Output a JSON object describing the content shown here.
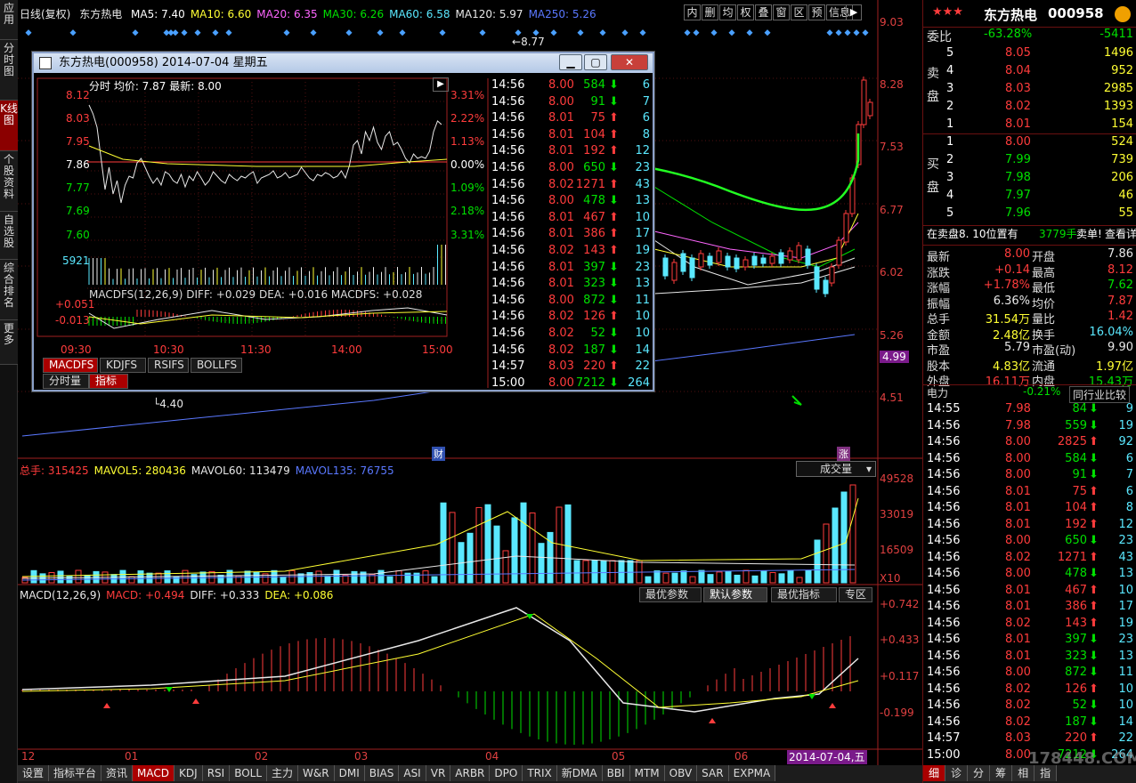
{
  "left_tabs": [
    "应用",
    "分时图",
    "K线图",
    "个股资料",
    "自选股",
    "综合排名",
    "更多"
  ],
  "header": {
    "period": "日线(复权)",
    "stock": "东方热电",
    "ma": [
      {
        "label": "MA5: 7.40",
        "color": "#ffffff"
      },
      {
        "label": "MA10: 6.60",
        "color": "#ffff33"
      },
      {
        "label": "MA20: 6.35",
        "color": "#ff66ff"
      },
      {
        "label": "MA30: 6.26",
        "color": "#00e000"
      },
      {
        "label": "MA60: 6.58",
        "color": "#5ae8ff"
      },
      {
        "label": "MA120: 5.97",
        "color": "#e8e8e8"
      },
      {
        "label": "MA250: 5.26",
        "color": "#5a78ff"
      }
    ],
    "tool_buttons": [
      "内",
      "删",
      "均",
      "权",
      "叠",
      "窗",
      "区",
      "预",
      "信息"
    ]
  },
  "price_axis": [
    "9.03",
    "8.28",
    "7.53",
    "6.77",
    "6.02",
    "5.26",
    "4.99",
    "4.51"
  ],
  "hi_label": "8.77",
  "lo_label": "4.40",
  "marks": {
    "cai": "财",
    "zhang": "涨"
  },
  "popup": {
    "title": "东方热电(000958) 2014-07-04 星期五",
    "info": "分时 均价: 7.87 最新: 8.00",
    "left_prices": [
      "8.12",
      "8.03",
      "7.95",
      "7.86",
      "7.77",
      "7.69",
      "7.60"
    ],
    "right_pcts": [
      "3.31%",
      "2.22%",
      "1.13%",
      "0.00%",
      "1.09%",
      "2.18%",
      "3.31%"
    ],
    "vol_label": "5921",
    "macd_info": "MACDFS(12,26,9) DIFF: +0.029 DEA: +0.016 MACDFS: +0.028",
    "macd_axis": [
      "+0.051",
      "-0.013"
    ],
    "times": [
      "09:30",
      "10:30",
      "11:30",
      "14:00",
      "15:00"
    ],
    "ind_tabs": [
      "MACDFS",
      "KDJFS",
      "RSIFS",
      "BOLLFS"
    ],
    "sub_tabs": [
      "分时量",
      "指标"
    ],
    "ticks": [
      {
        "t": "14:56",
        "p": "8.00",
        "v": "584",
        "d": "dn",
        "n": "6"
      },
      {
        "t": "14:56",
        "p": "8.00",
        "v": "91",
        "d": "dn",
        "n": "7"
      },
      {
        "t": "14:56",
        "p": "8.01",
        "v": "75",
        "d": "up",
        "n": "6"
      },
      {
        "t": "14:56",
        "p": "8.01",
        "v": "104",
        "d": "up",
        "n": "8"
      },
      {
        "t": "14:56",
        "p": "8.01",
        "v": "192",
        "d": "up",
        "n": "12"
      },
      {
        "t": "14:56",
        "p": "8.00",
        "v": "650",
        "d": "dn",
        "n": "23"
      },
      {
        "t": "14:56",
        "p": "8.02",
        "v": "1271",
        "d": "up",
        "n": "43"
      },
      {
        "t": "14:56",
        "p": "8.00",
        "v": "478",
        "d": "dn",
        "n": "13"
      },
      {
        "t": "14:56",
        "p": "8.01",
        "v": "467",
        "d": "up",
        "n": "10"
      },
      {
        "t": "14:56",
        "p": "8.01",
        "v": "386",
        "d": "up",
        "n": "17"
      },
      {
        "t": "14:56",
        "p": "8.02",
        "v": "143",
        "d": "up",
        "n": "19"
      },
      {
        "t": "14:56",
        "p": "8.01",
        "v": "397",
        "d": "dn",
        "n": "23"
      },
      {
        "t": "14:56",
        "p": "8.01",
        "v": "323",
        "d": "dn",
        "n": "13"
      },
      {
        "t": "14:56",
        "p": "8.00",
        "v": "872",
        "d": "dn",
        "n": "11"
      },
      {
        "t": "14:56",
        "p": "8.02",
        "v": "126",
        "d": "up",
        "n": "10"
      },
      {
        "t": "14:56",
        "p": "8.02",
        "v": "52",
        "d": "dn",
        "n": "10"
      },
      {
        "t": "14:56",
        "p": "8.02",
        "v": "187",
        "d": "dn",
        "n": "14"
      },
      {
        "t": "14:57",
        "p": "8.03",
        "v": "220",
        "d": "up",
        "n": "22"
      },
      {
        "t": "15:00",
        "p": "8.00",
        "v": "7212",
        "d": "dn",
        "n": "264"
      }
    ]
  },
  "volume": {
    "info": [
      {
        "label": "总手: 315425",
        "color": "#ff3c3c"
      },
      {
        "label": "MAVOL5: 280436",
        "color": "#ffff33"
      },
      {
        "label": "MAVOL60: 113479",
        "color": "#e8e8e8"
      },
      {
        "label": "MAVOL135: 76755",
        "color": "#5a78ff"
      }
    ],
    "select": "成交量",
    "axis": [
      "49528",
      "33019",
      "16509",
      "X10"
    ]
  },
  "macd": {
    "info": [
      {
        "label": "MACD(12,26,9)",
        "color": "#e8e8e8"
      },
      {
        "label": "MACD: +0.494",
        "color": "#ff3c3c"
      },
      {
        "label": "DIFF: +0.333",
        "color": "#e8e8e8"
      },
      {
        "label": "DEA: +0.086",
        "color": "#ffff33"
      }
    ],
    "buttons": [
      "最优参数",
      "默认参数",
      "最优指标",
      "专区"
    ],
    "axis": [
      "+0.742",
      "+0.433",
      "+0.117",
      "-0.199"
    ]
  },
  "months": [
    "12",
    "01",
    "02",
    "03",
    "04",
    "05",
    "06"
  ],
  "date_tag": "2014-07-04,五",
  "bottom_tabs": [
    "设置",
    "指标平台",
    "资讯",
    "MACD",
    "KDJ",
    "RSI",
    "BOLL",
    "主力",
    "W&R",
    "DMI",
    "BIAS",
    "ASI",
    "VR",
    "ARBR",
    "DPO",
    "TRIX",
    "新DMA",
    "BBI",
    "MTM",
    "OBV",
    "SAR",
    "EXPMA"
  ],
  "right": {
    "stars": "★★★",
    "name": "东方热电",
    "code": "000958",
    "weibi": {
      "label": "委比",
      "pct": "-63.28%",
      "diff": "-5411"
    },
    "sell": [
      {
        "n": "5",
        "p": "8.05",
        "v": "1496"
      },
      {
        "n": "4",
        "p": "8.04",
        "v": "952"
      },
      {
        "n": "3",
        "p": "8.03",
        "v": "2985"
      },
      {
        "n": "2",
        "p": "8.02",
        "v": "1393"
      },
      {
        "n": "1",
        "p": "8.01",
        "v": "154"
      }
    ],
    "sell_label": "卖盘",
    "buy": [
      {
        "n": "1",
        "p": "8.00",
        "v": "524"
      },
      {
        "n": "2",
        "p": "7.99",
        "v": "739"
      },
      {
        "n": "3",
        "p": "7.98",
        "v": "206"
      },
      {
        "n": "4",
        "p": "7.97",
        "v": "46"
      },
      {
        "n": "5",
        "p": "7.96",
        "v": "55"
      }
    ],
    "buy_label": "买盘",
    "notice": {
      "a": "在卖盘8. 10位置有",
      "b": "3779手",
      "c": "卖单!",
      "d": "查看详情"
    },
    "quote": [
      {
        "l1": "最新",
        "v1": "8.00",
        "c1": "#ff3c3c",
        "l2": "开盘",
        "v2": "7.86",
        "c2": "#e8e8e8"
      },
      {
        "l1": "涨跌",
        "v1": "+0.14",
        "c1": "#ff3c3c",
        "l2": "最高",
        "v2": "8.12",
        "c2": "#ff3c3c"
      },
      {
        "l1": "涨幅",
        "v1": "+1.78%",
        "c1": "#ff3c3c",
        "l2": "最低",
        "v2": "7.62",
        "c2": "#00e000"
      },
      {
        "l1": "振幅",
        "v1": "6.36%",
        "c1": "#e8e8e8",
        "l2": "均价",
        "v2": "7.87",
        "c2": "#ff3c3c"
      },
      {
        "l1": "总手",
        "v1": "31.54万",
        "c1": "#ffff33",
        "l2": "量比",
        "v2": "1.42",
        "c2": "#ff3c3c"
      },
      {
        "l1": "金额",
        "v1": "2.48亿",
        "c1": "#ffff33",
        "l2": "换手",
        "v2": "16.04%",
        "c2": "#5ae8ff"
      },
      {
        "l1": "市盈",
        "v1": "5.79",
        "c1": "#e8e8e8",
        "l2": "市盈(动)",
        "v2": "9.90",
        "c2": "#e8e8e8"
      },
      {
        "l1": "股本",
        "v1": "4.83亿",
        "c1": "#ffff33",
        "l2": "流通",
        "v2": "1.97亿",
        "c2": "#ffff33"
      },
      {
        "l1": "外盘",
        "v1": "16.11万",
        "c1": "#ff3c3c",
        "l2": "内盘",
        "v2": "15.43万",
        "c2": "#00e000"
      }
    ],
    "sector": {
      "label": "电力",
      "pct": "-0.21%",
      "compare": "同行业比较"
    },
    "ticks": [
      {
        "t": "14:55",
        "p": "7.98",
        "pc": "#ff3c3c",
        "v": "84",
        "d": "dn",
        "n": "9"
      },
      {
        "t": "14:56",
        "p": "7.98",
        "pc": "#ff3c3c",
        "v": "559",
        "d": "dn",
        "n": "19"
      },
      {
        "t": "14:56",
        "p": "8.00",
        "pc": "#ff3c3c",
        "v": "2825",
        "d": "up",
        "n": "92"
      },
      {
        "t": "14:56",
        "p": "8.00",
        "pc": "#ff3c3c",
        "v": "584",
        "d": "dn",
        "n": "6"
      },
      {
        "t": "14:56",
        "p": "8.00",
        "pc": "#ff3c3c",
        "v": "91",
        "d": "dn",
        "n": "7"
      },
      {
        "t": "14:56",
        "p": "8.01",
        "pc": "#ff3c3c",
        "v": "75",
        "d": "up",
        "n": "6"
      },
      {
        "t": "14:56",
        "p": "8.01",
        "pc": "#ff3c3c",
        "v": "104",
        "d": "up",
        "n": "8"
      },
      {
        "t": "14:56",
        "p": "8.01",
        "pc": "#ff3c3c",
        "v": "192",
        "d": "up",
        "n": "12"
      },
      {
        "t": "14:56",
        "p": "8.00",
        "pc": "#ff3c3c",
        "v": "650",
        "d": "dn",
        "n": "23"
      },
      {
        "t": "14:56",
        "p": "8.02",
        "pc": "#ff3c3c",
        "v": "1271",
        "d": "up",
        "n": "43"
      },
      {
        "t": "14:56",
        "p": "8.00",
        "pc": "#ff3c3c",
        "v": "478",
        "d": "dn",
        "n": "13"
      },
      {
        "t": "14:56",
        "p": "8.01",
        "pc": "#ff3c3c",
        "v": "467",
        "d": "up",
        "n": "10"
      },
      {
        "t": "14:56",
        "p": "8.01",
        "pc": "#ff3c3c",
        "v": "386",
        "d": "up",
        "n": "17"
      },
      {
        "t": "14:56",
        "p": "8.02",
        "pc": "#ff3c3c",
        "v": "143",
        "d": "up",
        "n": "19"
      },
      {
        "t": "14:56",
        "p": "8.01",
        "pc": "#ff3c3c",
        "v": "397",
        "d": "dn",
        "n": "23"
      },
      {
        "t": "14:56",
        "p": "8.01",
        "pc": "#ff3c3c",
        "v": "323",
        "d": "dn",
        "n": "13"
      },
      {
        "t": "14:56",
        "p": "8.00",
        "pc": "#ff3c3c",
        "v": "872",
        "d": "dn",
        "n": "11"
      },
      {
        "t": "14:56",
        "p": "8.02",
        "pc": "#ff3c3c",
        "v": "126",
        "d": "up",
        "n": "10"
      },
      {
        "t": "14:56",
        "p": "8.02",
        "pc": "#ff3c3c",
        "v": "52",
        "d": "dn",
        "n": "10"
      },
      {
        "t": "14:56",
        "p": "8.02",
        "pc": "#ff3c3c",
        "v": "187",
        "d": "dn",
        "n": "14"
      },
      {
        "t": "14:57",
        "p": "8.03",
        "pc": "#ff3c3c",
        "v": "220",
        "d": "up",
        "n": "22"
      },
      {
        "t": "15:00",
        "p": "8.00",
        "pc": "#ff3c3c",
        "v": "7212",
        "d": "dn",
        "n": "264"
      }
    ],
    "bottom_tabs": [
      "细",
      "诊",
      "分",
      "筹",
      "相",
      "指"
    ],
    "watermark": "178448.COM"
  }
}
